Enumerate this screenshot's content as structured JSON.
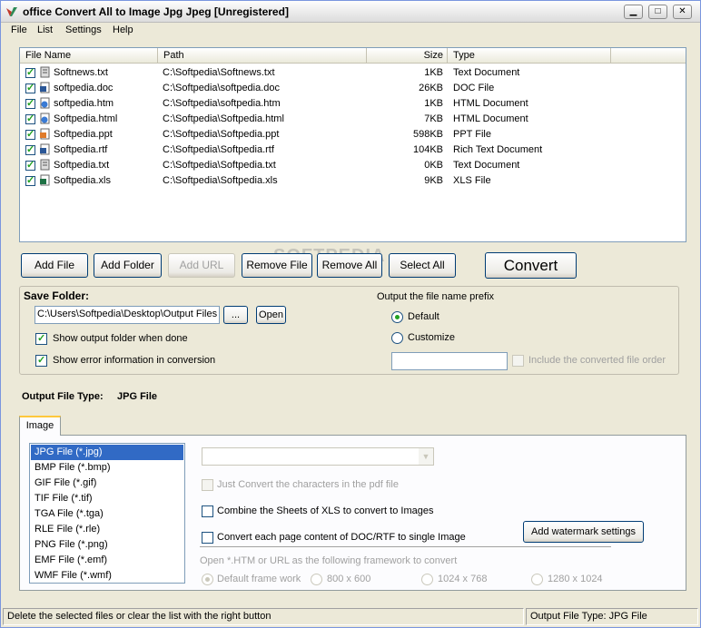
{
  "window": {
    "title": "office Convert All to Image Jpg Jpeg [Unregistered]",
    "controls": {
      "minimize": "▁",
      "maximize": "□",
      "close": "✕"
    }
  },
  "menu": [
    "File",
    "List",
    "Settings",
    "Help"
  ],
  "file_list": {
    "columns": [
      "File Name",
      "Path",
      "Size",
      "Type"
    ],
    "rows": [
      {
        "checked": true,
        "icon": "text-file-icon",
        "name": "Softnews.txt",
        "path": "C:\\Softpedia\\Softnews.txt",
        "size": "1KB",
        "type": "Text Document"
      },
      {
        "checked": true,
        "icon": "word-file-icon",
        "name": "softpedia.doc",
        "path": "C:\\Softpedia\\softpedia.doc",
        "size": "26KB",
        "type": "DOC File"
      },
      {
        "checked": true,
        "icon": "html-file-icon",
        "name": "softpedia.htm",
        "path": "C:\\Softpedia\\softpedia.htm",
        "size": "1KB",
        "type": "HTML Document"
      },
      {
        "checked": true,
        "icon": "html-file-icon",
        "name": "Softpedia.html",
        "path": "C:\\Softpedia\\Softpedia.html",
        "size": "7KB",
        "type": "HTML Document"
      },
      {
        "checked": true,
        "icon": "ppt-file-icon",
        "name": "Softpedia.ppt",
        "path": "C:\\Softpedia\\Softpedia.ppt",
        "size": "598KB",
        "type": "PPT File"
      },
      {
        "checked": true,
        "icon": "word-file-icon",
        "name": "Softpedia.rtf",
        "path": "C:\\Softpedia\\Softpedia.rtf",
        "size": "104KB",
        "type": "Rich Text Document"
      },
      {
        "checked": true,
        "icon": "text-file-icon",
        "name": "Softpedia.txt",
        "path": "C:\\Softpedia\\Softpedia.txt",
        "size": "0KB",
        "type": "Text Document"
      },
      {
        "checked": true,
        "icon": "excel-file-icon",
        "name": "Softpedia.xls",
        "path": "C:\\Softpedia\\Softpedia.xls",
        "size": "9KB",
        "type": "XLS File"
      }
    ]
  },
  "toolbar": {
    "add_file": "Add File",
    "add_folder": "Add Folder",
    "add_url": "Add URL",
    "remove_file": "Remove File",
    "remove_all": "Remove All",
    "select_all": "Select All",
    "convert": "Convert"
  },
  "save_folder": {
    "label": "Save Folder:",
    "path": "C:\\Users\\Softpedia\\Desktop\\Output Files",
    "browse": "...",
    "open": "Open",
    "show_output": "Show output folder when done",
    "show_error": "Show error information in conversion",
    "show_output_checked": true,
    "show_error_checked": true
  },
  "prefix": {
    "label": "Output the file name prefix",
    "default": "Default",
    "customize": "Customize",
    "selected": "Default",
    "custom_value": "",
    "include_order": "Include the converted file order"
  },
  "output_type": {
    "label": "Output File Type:",
    "value": "JPG File"
  },
  "tab": {
    "image": "Image"
  },
  "formats": [
    "JPG File  (*.jpg)",
    "BMP File  (*.bmp)",
    "GIF File  (*.gif)",
    "TIF File  (*.tif)",
    "TGA File  (*.tga)",
    "RLE File  (*.rle)",
    "PNG File  (*.png)",
    "EMF File  (*.emf)",
    "WMF File  (*.wmf)"
  ],
  "selected_format": "JPG File  (*.jpg)",
  "options": {
    "just_convert_pdf": "Just Convert the characters in the pdf file",
    "combine_xls": "Combine the Sheets of XLS to convert to Images",
    "convert_each_page": "Convert each page content of DOC/RTF to single Image",
    "watermark": "Add watermark settings",
    "html_framework_label": "Open *.HTM or URL as the following framework to convert",
    "frameworks": [
      "Default frame work",
      "800 x 600",
      "1024 x 768",
      "1280 x 1024"
    ]
  },
  "status": {
    "hint": "Delete the selected files or clear the list with the right button",
    "output_type": "Output File Type:  JPG File"
  },
  "watermark_text": "SOFTPEDIA"
}
